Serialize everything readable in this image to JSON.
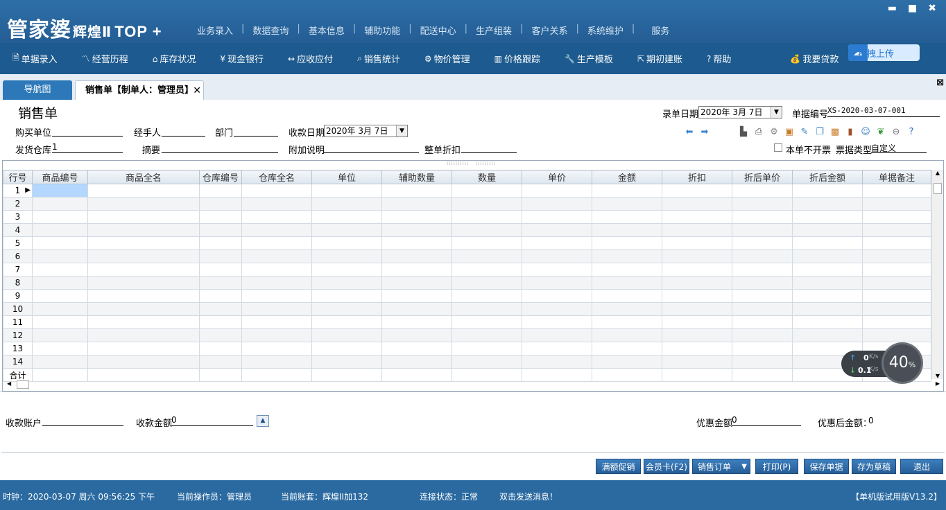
{
  "app": {
    "logo": "管家婆",
    "logo_sub": "辉煌Ⅱ",
    "logo_top": "TOP +",
    "top_menu": [
      "业务录入",
      "数据查询",
      "基本信息",
      "辅助功能",
      "配送中心",
      "生产组装",
      "客户关系",
      "系统维护",
      "服务"
    ],
    "window_controls": [
      "▬",
      "■",
      "✖"
    ]
  },
  "toolbar": {
    "items": [
      {
        "icon": "document-icon",
        "glyph": "🗎",
        "label": "单据录入"
      },
      {
        "icon": "chart-icon",
        "glyph": "〽",
        "label": "经营历程"
      },
      {
        "icon": "home-icon",
        "glyph": "⌂",
        "label": "库存状况"
      },
      {
        "icon": "yen-icon",
        "glyph": "¥",
        "label": "现金银行"
      },
      {
        "icon": "exchange-icon",
        "glyph": "↔",
        "label": "应收应付"
      },
      {
        "icon": "search-icon",
        "glyph": "⌕",
        "label": "销售统计"
      },
      {
        "icon": "gear-icon",
        "glyph": "⚙",
        "label": "物价管理"
      },
      {
        "icon": "bar-chart-icon",
        "glyph": "▥",
        "label": "价格跟踪"
      },
      {
        "icon": "wrench-icon",
        "glyph": "🔧",
        "label": "生产模板"
      },
      {
        "icon": "external-icon",
        "glyph": "⇱",
        "label": "期初建账"
      },
      {
        "icon": "help-icon",
        "glyph": "?",
        "label": "帮助"
      },
      {
        "icon": "money-bag-icon",
        "glyph": "💰",
        "label": "我要贷款"
      }
    ],
    "cloud_upload": "拖拽上传"
  },
  "tabs": {
    "nav": "导航图",
    "active": "销售单【制单人：管理员】",
    "close": "✕"
  },
  "form": {
    "title": "销售单",
    "entry_date_label": "录单日期",
    "entry_date": "2020年 3月 7日",
    "doc_no_label": "单据编号",
    "doc_no": "XS-2020-03-07-001",
    "buyer_label": "购买单位",
    "buyer": "",
    "handler_label": "经手人",
    "handler": "",
    "dept_label": "部门",
    "dept": "",
    "receipt_date_label": "收款日期",
    "receipt_date": "2020年 3月 7日",
    "warehouse_label": "发货仓库",
    "warehouse": "1",
    "summary_label": "摘要",
    "summary": "",
    "note_label": "附加说明",
    "note": "",
    "discount_label": "整单折扣",
    "discount": "",
    "no_invoice_label": "本单不开票",
    "bill_type_label": "票据类型",
    "bill_type": "自定义"
  },
  "grid": {
    "columns": [
      "行号",
      "商品编号",
      "商品全名",
      "仓库编号",
      "仓库全名",
      "单位",
      "辅助数量",
      "数量",
      "单价",
      "金额",
      "折扣",
      "折后单价",
      "折后金额",
      "单据备注"
    ],
    "rows": [
      "1",
      "2",
      "3",
      "4",
      "5",
      "6",
      "7",
      "8",
      "9",
      "10",
      "11",
      "12",
      "13",
      "14"
    ],
    "total_label": "合计"
  },
  "speed": {
    "up": "0",
    "up_unit": "K/s",
    "down": "0.1",
    "down_unit": "K/s",
    "percent": "40",
    "percent_unit": "%"
  },
  "footer": {
    "account_label": "收款账户",
    "account": "",
    "amount_label": "收款金额",
    "amount": "0",
    "discount_amt_label": "优惠金额",
    "discount_amt": "0",
    "after_discount_label": "优惠后金额：",
    "after_discount": "0"
  },
  "buttons": [
    "满额促销",
    "会员卡(F2)",
    "销售订单",
    "打印(P)",
    "保存单据",
    "存为草稿",
    "退出"
  ],
  "status": {
    "clock": "时钟：2020-03-07 周六 09:56:25 下午",
    "operator": "当前操作员：管理员",
    "account_set": "当前账套：辉煌II加132",
    "connection": "连接状态：正常",
    "message": "双击发送消息！",
    "version": "【单机版试用版V13.2】"
  }
}
